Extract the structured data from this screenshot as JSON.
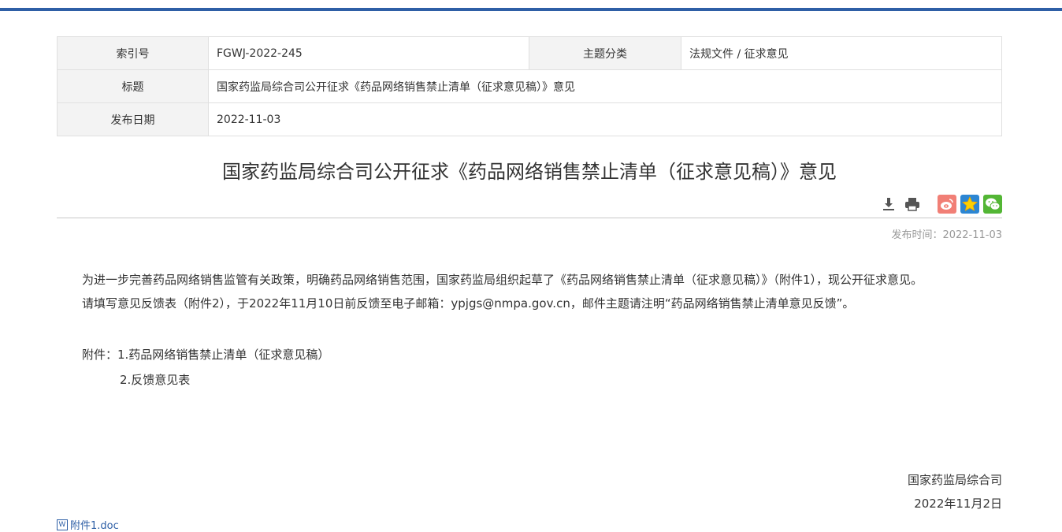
{
  "meta": {
    "index_label": "索引号",
    "index_value": "FGWJ-2022-245",
    "category_label": "主题分类",
    "category_value": "法规文件 / 征求意见",
    "title_label": "标题",
    "title_value": "国家药监局综合司公开征求《药品网络销售禁止清单（征求意见稿）》意见",
    "date_label": "发布日期",
    "date_value": "2022-11-03"
  },
  "article": {
    "title": "国家药监局综合司公开征求《药品网络销售禁止清单（征求意见稿）》意见",
    "publish_time": "发布时间：2022-11-03",
    "paragraph1": "为进一步完善药品网络销售监管有关政策，明确药品网络销售范围，国家药监局组织起草了《药品网络销售禁止清单（征求意见稿）》（附件1），现公开征求意见。",
    "paragraph2": "请填写意见反馈表（附件2），于2022年11月10日前反馈至电子邮箱：ypjgs@nmpa.gov.cn，邮件主题请注明“药品网络销售禁止清单意见反馈”。",
    "attachments_row1": "附件：1.药品网络销售禁止清单（征求意见稿）",
    "attachments_row2": "2.反馈意见表",
    "sign_org": "国家药监局综合司",
    "sign_date": "2022年11月2日",
    "doc_link": "附件1.doc"
  },
  "icons": {
    "download": "download-icon",
    "print": "print-icon",
    "weibo": "weibo-icon",
    "qzone": "qzone-star-icon",
    "wechat": "wechat-icon"
  },
  "colors": {
    "accent": "#2e5fa6",
    "table_header_bg": "#f3f3f3",
    "muted": "#999999"
  }
}
